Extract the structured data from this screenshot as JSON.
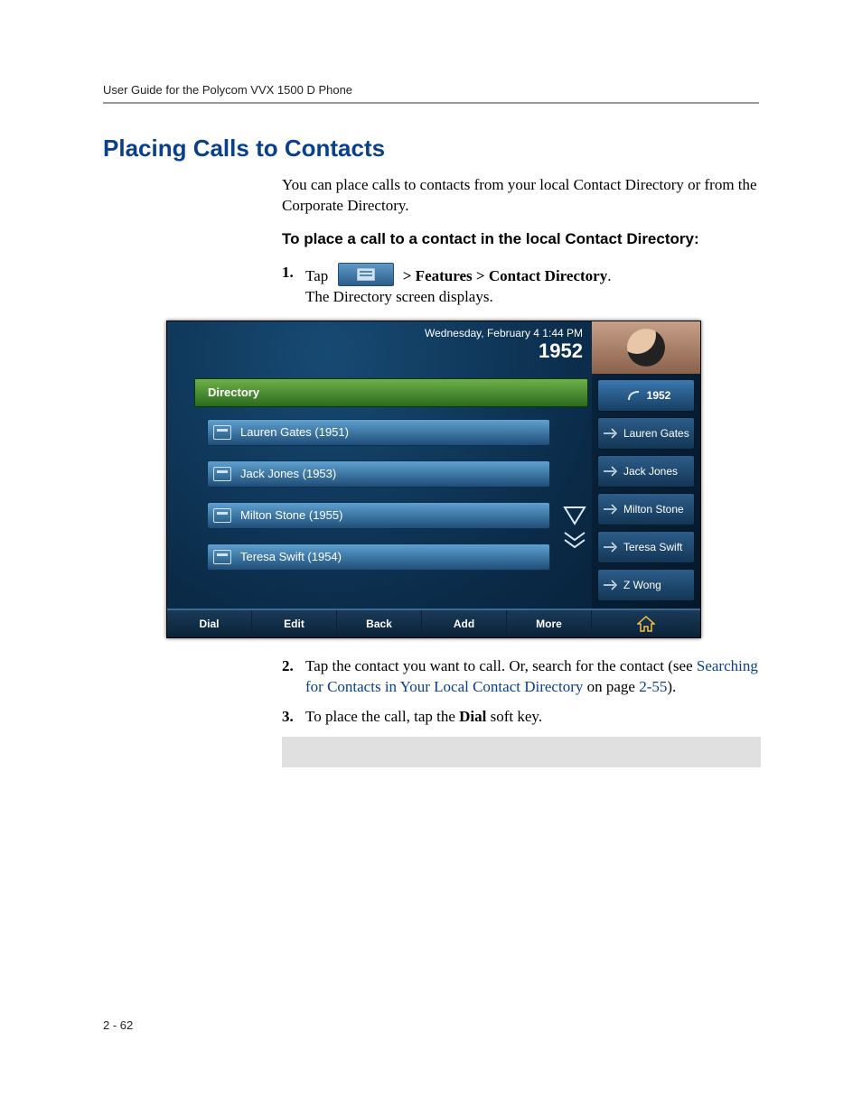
{
  "doc": {
    "running_head": "User Guide for the Polycom VVX 1500 D Phone",
    "page_number": "2 - 62",
    "h1": "Placing Calls to Contacts",
    "intro": "You can place calls to contacts from your local Contact Directory or from the Corporate Directory.",
    "subhead": "To place a call to a contact in the local Contact Directory:",
    "step1_pre": "Tap",
    "step1_post": "> Features > Contact Directory",
    "step1_tail": ".",
    "step1_result": "The Directory screen displays.",
    "step2a": "Tap the contact you want to call. Or, search for the contact (see ",
    "step2b_link": "Searching for Contacts in Your Local Contact Directory",
    "step2c": " on page ",
    "step2d_link": "2-55",
    "step2e": ").",
    "step3a": "To place the call, tap the ",
    "step3b_bold": "Dial",
    "step3c": " soft key."
  },
  "phone": {
    "datetime": "Wednesday, February 4  1:44 PM",
    "extension": "1952",
    "title_bar": "Directory",
    "contacts": [
      "Lauren Gates (1951)",
      "Jack Jones (1953)",
      "Milton Stone (1955)",
      "Teresa Swift (1954)"
    ],
    "rail": [
      "1952",
      "Lauren Gates",
      "Jack Jones",
      "Milton Stone",
      "Teresa Swift",
      "Z Wong"
    ],
    "softkeys": [
      "Dial",
      "Edit",
      "Back",
      "Add",
      "More"
    ]
  }
}
